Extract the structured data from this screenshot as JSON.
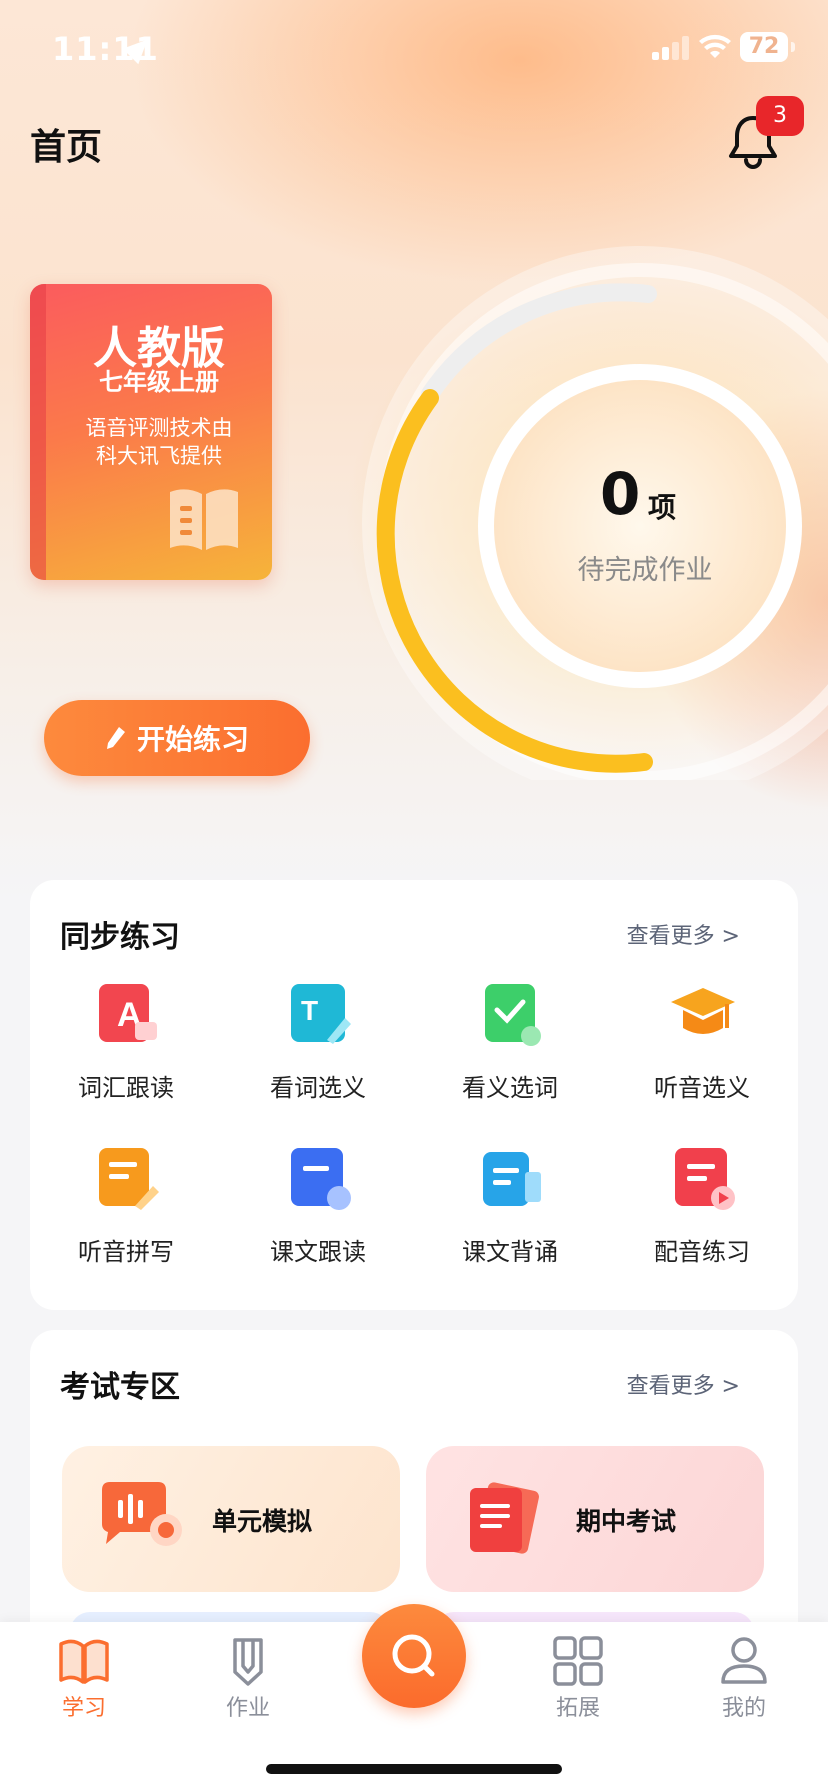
{
  "status_bar": {
    "time": "11:11",
    "battery": "72"
  },
  "header": {
    "title": "首页",
    "notification_count": "3"
  },
  "textbook": {
    "edition": "人教版",
    "grade": "七年级上册",
    "credit_line1": "语音评测技术由",
    "credit_line2": "科大讯飞提供"
  },
  "homework": {
    "count": "0",
    "unit": "项",
    "label": "待完成作业"
  },
  "start_button": {
    "label": "开始练习"
  },
  "sync_practice": {
    "title": "同步练习",
    "more": "查看更多 >",
    "items": [
      {
        "label": "词汇跟读",
        "icon": "vocab-read-icon"
      },
      {
        "label": "看词选义",
        "icon": "word-meaning-icon"
      },
      {
        "label": "看义选词",
        "icon": "meaning-word-icon"
      },
      {
        "label": "听音选义",
        "icon": "listen-meaning-icon"
      },
      {
        "label": "听音拼写",
        "icon": "listen-spell-icon"
      },
      {
        "label": "课文跟读",
        "icon": "text-read-icon"
      },
      {
        "label": "课文背诵",
        "icon": "text-recite-icon"
      },
      {
        "label": "配音练习",
        "icon": "dubbing-icon"
      }
    ]
  },
  "exam_zone": {
    "title": "考试专区",
    "more": "查看更多 >",
    "items": [
      {
        "label": "单元模拟",
        "icon": "unit-mock-icon"
      },
      {
        "label": "期中考试",
        "icon": "midterm-icon"
      }
    ]
  },
  "tabbar": {
    "items": [
      {
        "label": "学习",
        "icon": "book-icon",
        "active": true
      },
      {
        "label": "作业",
        "icon": "homework-icon",
        "active": false
      },
      {
        "label": "拓展",
        "icon": "grid-icon",
        "active": false
      },
      {
        "label": "我的",
        "icon": "profile-icon",
        "active": false
      }
    ],
    "center_icon": "search-icon"
  },
  "colors": {
    "accent": "#fb6e2f",
    "ring_yellow": "#fbbf1f",
    "badge_red": "#e8262a"
  }
}
